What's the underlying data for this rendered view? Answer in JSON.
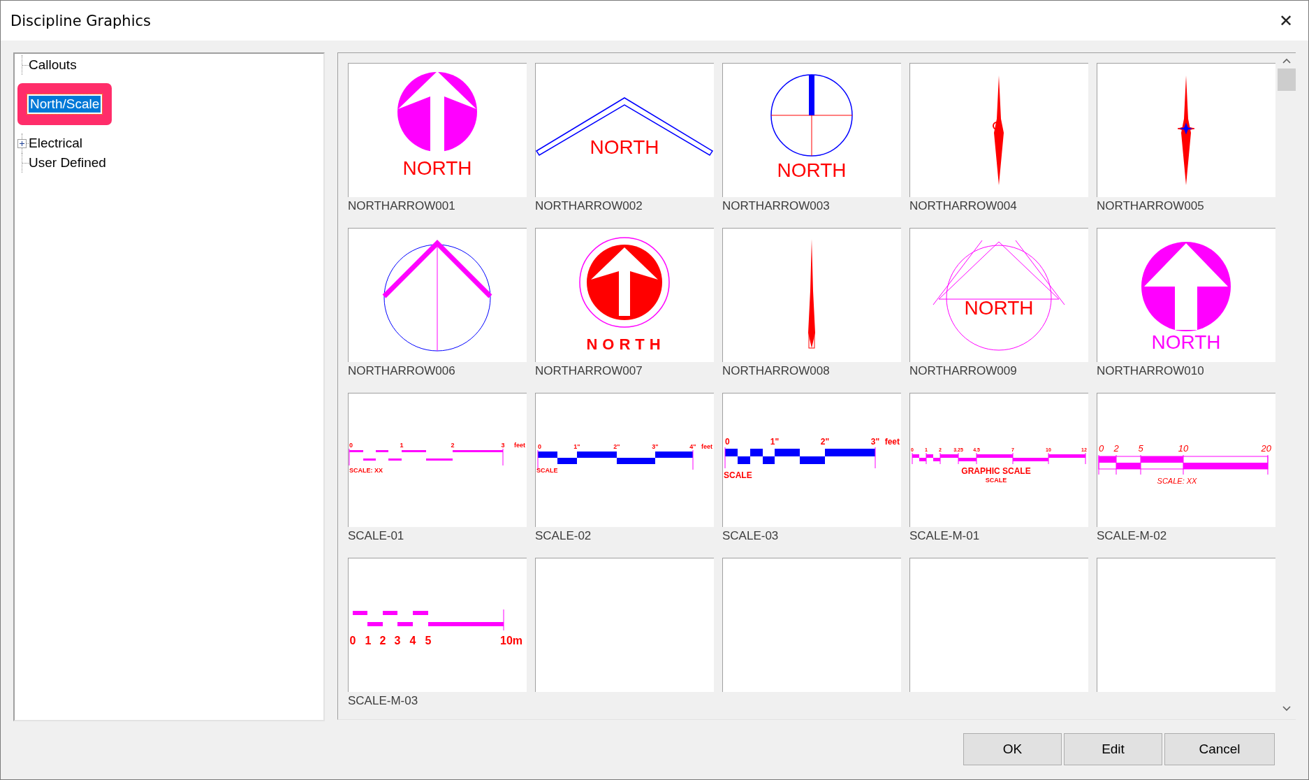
{
  "window": {
    "title": "Discipline Graphics",
    "close": "✕"
  },
  "tree": [
    {
      "label": "Callouts",
      "kind": "leaf",
      "selected": false,
      "highlighted": false
    },
    {
      "label": "North/Scale",
      "kind": "leaf",
      "selected": true,
      "highlighted": true
    },
    {
      "label": "Electrical",
      "kind": "folder",
      "expanded": false,
      "selected": false,
      "highlighted": false
    },
    {
      "label": "User Defined",
      "kind": "leaf",
      "selected": false,
      "highlighted": false
    }
  ],
  "gallery": [
    {
      "name": "NORTHARROW001",
      "kind": "disc",
      "texts": [
        "NORTH"
      ]
    },
    {
      "name": "NORTHARROW002",
      "kind": "chevron",
      "texts": [
        "NORTH"
      ]
    },
    {
      "name": "NORTHARROW003",
      "kind": "crosshair",
      "texts": [
        "NORTH"
      ]
    },
    {
      "name": "NORTHARROW004",
      "kind": "needle"
    },
    {
      "name": "NORTHARROW005",
      "kind": "needlestar"
    },
    {
      "name": "NORTHARROW006",
      "kind": "circlechevron"
    },
    {
      "name": "NORTHARROW007",
      "kind": "ringdisc",
      "texts": [
        "NORTH"
      ]
    },
    {
      "name": "NORTHARROW008",
      "kind": "spike"
    },
    {
      "name": "NORTHARROW009",
      "kind": "circletriangle",
      "texts": [
        "NORTH"
      ]
    },
    {
      "name": "NORTHARROW010",
      "kind": "magentadisc",
      "texts": [
        "NORTH"
      ]
    },
    {
      "name": "SCALE-01",
      "kind": "scale1",
      "texts": [
        "0",
        "1",
        "2",
        "3",
        "feet",
        "SCALE: XX"
      ]
    },
    {
      "name": "SCALE-02",
      "kind": "scale2",
      "texts": [
        "0",
        "1\"",
        "2\"",
        "3\"",
        "4\"",
        "feet",
        "SCALE"
      ]
    },
    {
      "name": "SCALE-03",
      "kind": "scale3",
      "texts": [
        "0",
        "1\"",
        "2\"",
        "3\"",
        "feet",
        "SCALE"
      ]
    },
    {
      "name": "SCALE-M-01",
      "kind": "scalem1",
      "texts": [
        "0",
        "1",
        "2",
        "3.25",
        "4.5",
        "7",
        "10",
        "12",
        "GRAPHIC  SCALE",
        "SCALE"
      ]
    },
    {
      "name": "SCALE-M-02",
      "kind": "scalem2",
      "texts": [
        "0",
        "2",
        "5",
        "10",
        "20",
        "SCALE: XX"
      ]
    },
    {
      "name": "SCALE-M-03",
      "kind": "scalem3",
      "texts": [
        "0",
        "1",
        "2",
        "3",
        "4",
        "5",
        "10m"
      ]
    },
    {
      "kind": "empty"
    },
    {
      "kind": "empty"
    },
    {
      "kind": "empty"
    },
    {
      "kind": "empty"
    }
  ],
  "buttons": [
    "OK",
    "Edit",
    "Cancel"
  ]
}
